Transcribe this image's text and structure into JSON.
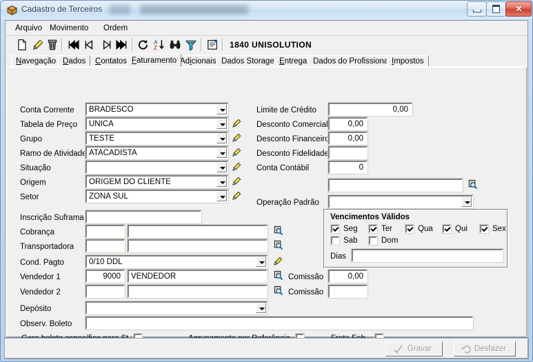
{
  "window": {
    "title": "Cadastro de Terceiros",
    "title_redacted": "",
    "icon": "package-icon",
    "controls": {
      "minimize": "minimize-button",
      "maximize": "maximize-button",
      "close_glyph": "✕"
    }
  },
  "menubar": {
    "items": [
      {
        "label": "Arquivo"
      },
      {
        "label": "Movimento"
      },
      {
        "label": "Ordem"
      }
    ]
  },
  "toolbar": {
    "icons": [
      "new-document-icon",
      "edit-pencil-icon",
      "delete-trash-icon",
      "first-record-icon",
      "previous-record-icon",
      "next-record-icon",
      "last-record-icon",
      "refresh-icon",
      "sort-az-icon",
      "find-binoculars-icon",
      "filter-funnel-icon",
      "report-properties-icon"
    ],
    "record_number": "1840",
    "record_name": "UNISOLUTION",
    "record_label": "1840   UNISOLUTION"
  },
  "tabs": [
    {
      "label": "Navegação",
      "accel": "N",
      "active": false
    },
    {
      "label": "Dados",
      "accel": "D",
      "active": false
    },
    {
      "label": "Contatos",
      "accel": "C",
      "active": false
    },
    {
      "label": "Faturamento",
      "accel": "F",
      "active": true
    },
    {
      "label": "Adicionais",
      "accel": "i",
      "active": false
    },
    {
      "label": "Dados Storage",
      "accel": "",
      "active": false
    },
    {
      "label": "Entrega",
      "accel": "E",
      "active": false
    },
    {
      "label": "Dados do Profissional",
      "accel": "",
      "active": false
    },
    {
      "label": "Impostos",
      "accel": "I",
      "active": false
    }
  ],
  "form": {
    "left": {
      "conta_corrente": {
        "label": "Conta Corrente",
        "value": "BRADESCO"
      },
      "tabela_de_preco": {
        "label": "Tabela de Preço",
        "value": "UNICA"
      },
      "grupo": {
        "label": "Grupo",
        "value": "TESTE"
      },
      "ramo_de_atividade": {
        "label": "Ramo de Atividade",
        "value": "ATACADISTA"
      },
      "situacao": {
        "label": "Situação",
        "value": ""
      },
      "origem": {
        "label": "Origem",
        "value": "ORIGEM DO CLIENTE"
      },
      "setor": {
        "label": "Setor",
        "value": "ZONA SUL"
      },
      "inscricao_suframa": {
        "label": "Inscrição Suframa",
        "value": ""
      },
      "cobranca": {
        "label": "Cobrança",
        "code": "",
        "description": ""
      },
      "transportadora": {
        "label": "Transportadora",
        "code": "",
        "description": ""
      },
      "cond_pagto": {
        "label": "Cond. Pagto",
        "value": "0/10 DDL"
      },
      "vendedor1": {
        "label": "Vendedor 1",
        "code": "9000",
        "description": "VENDEDOR",
        "comissao_label": "Comissão",
        "comissao": "0,00"
      },
      "vendedor2": {
        "label": "Vendedor 2",
        "code": "",
        "description": "",
        "comissao_label": "Comissão",
        "comissao": ""
      },
      "deposito": {
        "label": "Depósito",
        "value": ""
      },
      "observ_boleto": {
        "label": "Observ. Boleto",
        "value": ""
      }
    },
    "right": {
      "limite_de_credito": {
        "label": "Limite de Crédito",
        "value": "0,00"
      },
      "desconto_comercial": {
        "label": "Desconto Comercial",
        "value": "0,00"
      },
      "desconto_financeiro": {
        "label": "Desconto Financeiro",
        "value": "0,00"
      },
      "desconto_fidelidade": {
        "label": "Desconto Fidelidade",
        "value": ""
      },
      "conta_contabil": {
        "label": "Conta Contábil",
        "value": "0"
      },
      "conta_contabil_desc": {
        "value": ""
      },
      "operacao_padrao": {
        "label": "Operação Padrão",
        "value": ""
      }
    },
    "vencimentos": {
      "title": "Vencimentos Válidos",
      "days": [
        {
          "label": "Seg",
          "checked": true
        },
        {
          "label": "Ter",
          "checked": true
        },
        {
          "label": "Qua",
          "checked": true
        },
        {
          "label": "Qui",
          "checked": true
        },
        {
          "label": "Sex",
          "checked": true
        },
        {
          "label": "Sab",
          "checked": false
        },
        {
          "label": "Dom",
          "checked": false
        }
      ],
      "dias_label": "Dias",
      "dias_value": ""
    },
    "bottom_checks": [
      {
        "label": "Gera boleto específico para St",
        "checked": false
      },
      {
        "label": "Agrupamento por Referência",
        "checked": false
      },
      {
        "label": "Frete Fob",
        "checked": false
      }
    ]
  },
  "commands": {
    "gravar": {
      "label": "Gravar",
      "icon": "check-icon",
      "enabled": false
    },
    "desfazer": {
      "label": "Desfazer",
      "icon": "undo-icon",
      "enabled": false
    }
  },
  "colors": {
    "aero_frame": "#c3d8ef",
    "client_gray": "#f0f0f0",
    "field_white": "#ffffff",
    "close_red": "#cc4132",
    "disabled_text": "#9d9d9d"
  }
}
